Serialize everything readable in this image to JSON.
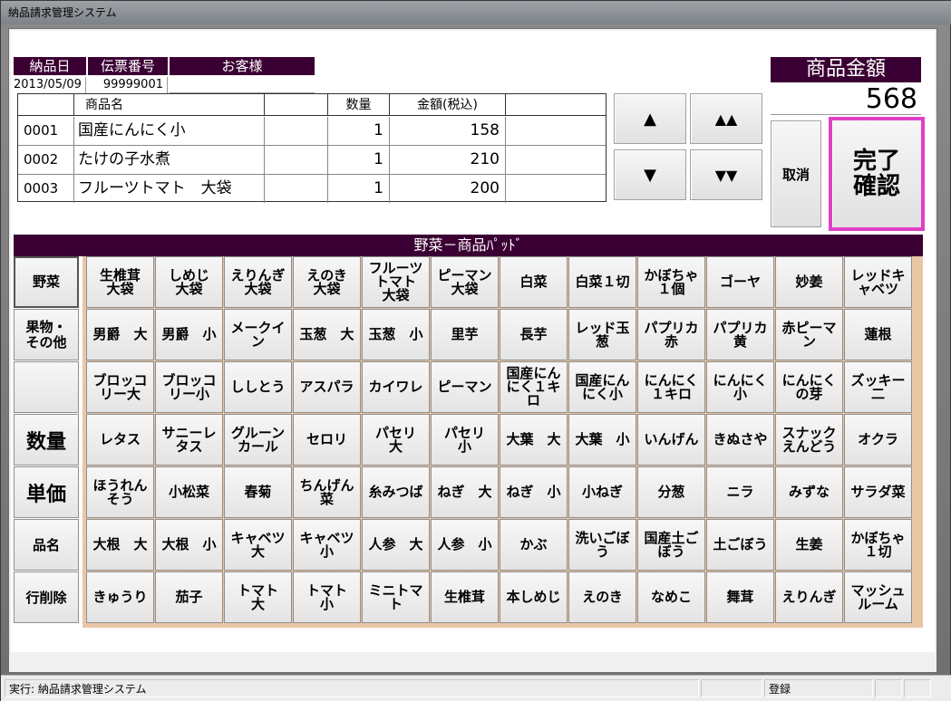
{
  "window": {
    "title": "納品請求管理システム"
  },
  "header": {
    "date_label": "納品日",
    "date_value": "2013/05/09",
    "slip_label": "伝票番号",
    "slip_value": "99999001",
    "customer_label": "お客様",
    "customer_value": ""
  },
  "table": {
    "columns": [
      "",
      "商品名",
      "",
      "数量",
      "金額(税込)",
      ""
    ],
    "rows": [
      {
        "code": "0001",
        "name": "国産にんにく小",
        "qty": "1",
        "price": "158"
      },
      {
        "code": "0002",
        "name": "たけの子水煮",
        "qty": "1",
        "price": "210"
      },
      {
        "code": "0003",
        "name": "フルーツトマト　大袋",
        "qty": "1",
        "price": "200"
      }
    ]
  },
  "nav": {
    "up": "▲",
    "page_up": "▲▲",
    "down": "▼",
    "page_down": "▼▼"
  },
  "amount": {
    "label": "商品金額",
    "value": "568"
  },
  "actions": {
    "cancel": "取消",
    "complete": "完了\n確認",
    "complete_border": "#e040c8"
  },
  "pad": {
    "title": "野菜－商品ﾊﾟｯﾄﾞ",
    "categories": [
      "野菜",
      "果物・\nその他",
      ""
    ],
    "functions": [
      "数量",
      "単価",
      "品名",
      "行削除"
    ],
    "items": [
      [
        "生椎茸\n大袋",
        "しめじ\n大袋",
        "えりんぎ\n大袋",
        "えのき\n大袋",
        "フルーツ\nトマト\n大袋",
        "ピーマン\n大袋",
        "白菜",
        "白菜１切",
        "かぼちゃ\n１個",
        "ゴーヤ",
        "妙姜",
        "レッドキ\nャベツ"
      ],
      [
        "男爵　大",
        "男爵　小",
        "メークイ\nン",
        "玉葱　大",
        "玉葱　小",
        "里芋",
        "長芋",
        "レッド玉\n葱",
        "パプリカ\n赤",
        "パプリカ\n黄",
        "赤ピーマ\nン",
        "蓮根"
      ],
      [
        "ブロッコ\nリー大",
        "ブロッコ\nリー小",
        "ししとう",
        "アスパラ",
        "カイワレ",
        "ピーマン",
        "国産にん\nにく１キ\nロ",
        "国産にん\nにく小",
        "にんにく\n１キロ",
        "にんにく\n小",
        "にんにく\nの芽",
        "ズッキー\n二"
      ],
      [
        "レタス",
        "サニーレ\nタス",
        "グルーン\nカール",
        "セロリ",
        "パセリ\n大",
        "パセリ\n小",
        "大葉　大",
        "大葉　小",
        "いんげん",
        "きぬさや",
        "スナック\nえんどう",
        "オクラ"
      ],
      [
        "ほうれん\nそう",
        "小松菜",
        "春菊",
        "ちんげん\n菜",
        "糸みつば",
        "ねぎ　大",
        "ねぎ　小",
        "小ねぎ",
        "分葱",
        "ニラ",
        "みずな",
        "サラダ菜"
      ],
      [
        "大根　大",
        "大根　小",
        "キャベツ\n大",
        "キャベツ\n小",
        "人参　大",
        "人参　小",
        "かぶ",
        "洗いごぼ\nう",
        "国産土ご\nぼう",
        "土ごぼう",
        "生姜",
        "かぼちゃ\n１切"
      ],
      [
        "きゅうり",
        "茄子",
        "トマト\n大",
        "トマト\n小",
        "ミニトマ\nト",
        "生椎茸",
        "本しめじ",
        "えのき",
        "なめこ",
        "舞茸",
        "えりんぎ",
        "マッシュ\nルーム"
      ]
    ]
  },
  "status": {
    "exec": "実行: 納品請求管理システム",
    "mode": "登録"
  }
}
